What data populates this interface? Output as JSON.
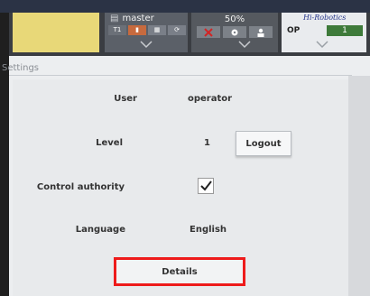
{
  "topbar": {
    "mode_label": "",
    "master_label": "master",
    "t1_label": "T1",
    "speed_label": "50%",
    "brand": "Hi-Robotics",
    "op_label": "OP",
    "op_value": "1"
  },
  "settings": {
    "title": "Settings",
    "user_label": "User",
    "user_value": "operator",
    "level_label": "Level",
    "level_value": "1",
    "logout_label": "Logout",
    "control_label": "Control authority",
    "control_checked": true,
    "language_label": "Language",
    "language_value": "English",
    "details_label": "Details"
  },
  "colors": {
    "highlight": "#ee1b1b",
    "mode_yellow": "#e8d878",
    "op_green": "#3e7a3a"
  }
}
